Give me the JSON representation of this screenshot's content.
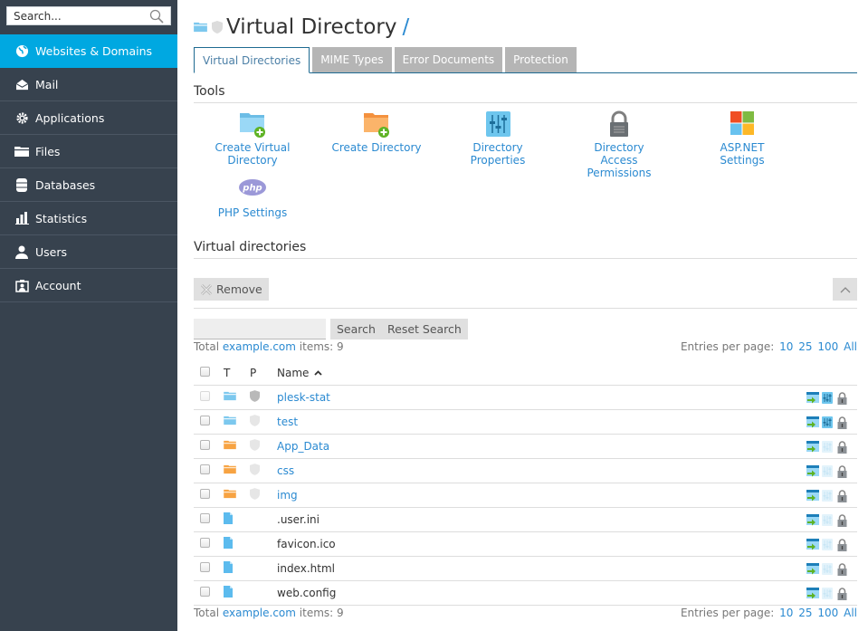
{
  "sidebar": {
    "search_placeholder": "Search...",
    "items": [
      {
        "label": "Websites & Domains",
        "icon": "globe-icon",
        "active": true
      },
      {
        "label": "Mail",
        "icon": "mail-icon"
      },
      {
        "label": "Applications",
        "icon": "gear-icon"
      },
      {
        "label": "Files",
        "icon": "folder-icon"
      },
      {
        "label": "Databases",
        "icon": "database-icon"
      },
      {
        "label": "Statistics",
        "icon": "bar-chart-icon"
      },
      {
        "label": "Users",
        "icon": "user-icon"
      },
      {
        "label": "Account",
        "icon": "account-icon"
      }
    ]
  },
  "header": {
    "title": "Virtual Directory",
    "path": "/"
  },
  "tabs": [
    {
      "label": "Virtual Directories",
      "active": true
    },
    {
      "label": "MIME Types"
    },
    {
      "label": "Error Documents"
    },
    {
      "label": "Protection"
    }
  ],
  "tools": {
    "title": "Tools",
    "items": [
      {
        "label": "Create Virtual Directory",
        "icon": "folder-add-blue-icon"
      },
      {
        "label": "Create Directory",
        "icon": "folder-add-orange-icon"
      },
      {
        "label": "Directory Properties",
        "icon": "sliders-icon"
      },
      {
        "label_line1": "Directory Access",
        "label_line2": "Permissions",
        "icon": "lock-icon"
      },
      {
        "label": "ASP.NET Settings",
        "icon": "windows-icon"
      },
      {
        "label": "PHP Settings",
        "icon": "php-icon"
      }
    ]
  },
  "list": {
    "title": "Virtual directories",
    "remove_label": "Remove",
    "search_value": "",
    "search_label": "Search",
    "reset_label": "Reset Search",
    "total_prefix": "Total",
    "total_domain": "example.com",
    "total_suffix": "items: 9",
    "entries_label": "Entries per page:",
    "entries_options": [
      "10",
      "25",
      "100",
      "All"
    ],
    "columns": {
      "type": "T",
      "protection": "P",
      "name": "Name",
      "sort": "ascending"
    },
    "rows": [
      {
        "name": "plesk-stat",
        "type": "virtual-directory",
        "link": true,
        "protected": true,
        "checkbox_disabled": true,
        "properties_enabled": true
      },
      {
        "name": "test",
        "type": "virtual-directory",
        "link": true,
        "protected": false,
        "checkbox_disabled": false,
        "properties_enabled": true
      },
      {
        "name": "App_Data",
        "type": "directory",
        "link": true,
        "protected": false,
        "checkbox_disabled": false,
        "properties_enabled": false
      },
      {
        "name": "css",
        "type": "directory",
        "link": true,
        "protected": false,
        "checkbox_disabled": false,
        "properties_enabled": false
      },
      {
        "name": "img",
        "type": "directory",
        "link": true,
        "protected": false,
        "checkbox_disabled": false,
        "properties_enabled": false
      },
      {
        "name": ".user.ini",
        "type": "file",
        "link": false,
        "protected": false,
        "checkbox_disabled": false,
        "properties_enabled": false
      },
      {
        "name": "favicon.ico",
        "type": "file",
        "link": false,
        "protected": false,
        "checkbox_disabled": false,
        "properties_enabled": false
      },
      {
        "name": "index.html",
        "type": "file",
        "link": false,
        "protected": false,
        "checkbox_disabled": false,
        "properties_enabled": false
      },
      {
        "name": "web.config",
        "type": "file",
        "link": false,
        "protected": false,
        "checkbox_disabled": false,
        "properties_enabled": false
      }
    ]
  }
}
